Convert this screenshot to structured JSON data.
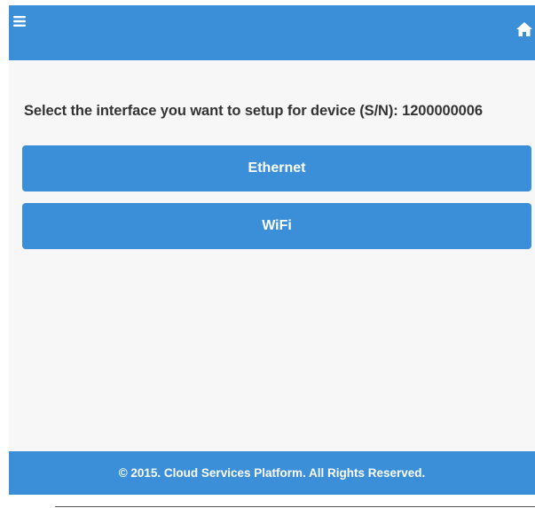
{
  "header": {
    "menu_icon": "hamburger-menu-icon",
    "home_icon": "home-icon"
  },
  "main": {
    "prompt": "Select the interface you want to setup for device (S/N): 1200000006",
    "options": [
      {
        "label": "Ethernet"
      },
      {
        "label": "WiFi"
      }
    ]
  },
  "footer": {
    "text": "© 2015. Cloud Services Platform. All Rights Reserved."
  },
  "colors": {
    "primary": "#3b8fd8",
    "background": "#f7f7f7",
    "text": "#333333",
    "button_text": "#ffffff"
  }
}
